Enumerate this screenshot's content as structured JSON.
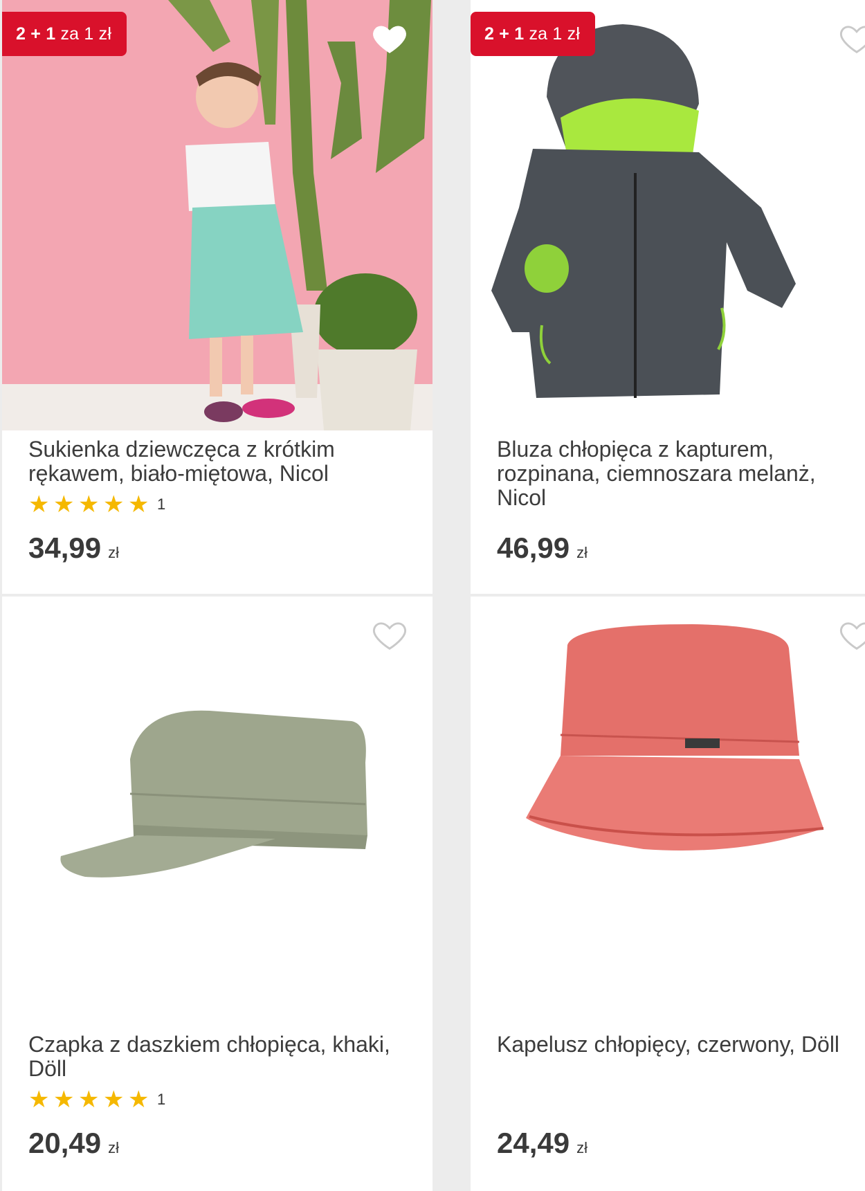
{
  "products": [
    {
      "badge": {
        "strong": "2 + 1",
        "rest": "za 1 zł"
      },
      "title": "Sukienka dziewczęca z krótkim rękawem, biało-miętowa, Nicol",
      "rating_count": "1",
      "price": "34,99",
      "currency": "zł",
      "favorite": true
    },
    {
      "badge": {
        "strong": "2 + 1",
        "rest": "za 1 zł"
      },
      "title": "Bluza chłopięca z kapturem, rozpinana, ciemnoszara melanż, Nicol",
      "price": "46,99",
      "currency": "zł",
      "favorite": false
    },
    {
      "title": "Czapka z daszkiem chłopięca, khaki, Döll",
      "rating_count": "1",
      "price": "20,49",
      "currency": "zł",
      "favorite": false
    },
    {
      "title": "Kapelusz chłopięcy, czerwony, Döll",
      "price": "24,49",
      "currency": "zł",
      "favorite": false
    }
  ],
  "colors": {
    "accent": "#d9112b",
    "star": "#f5b800"
  }
}
